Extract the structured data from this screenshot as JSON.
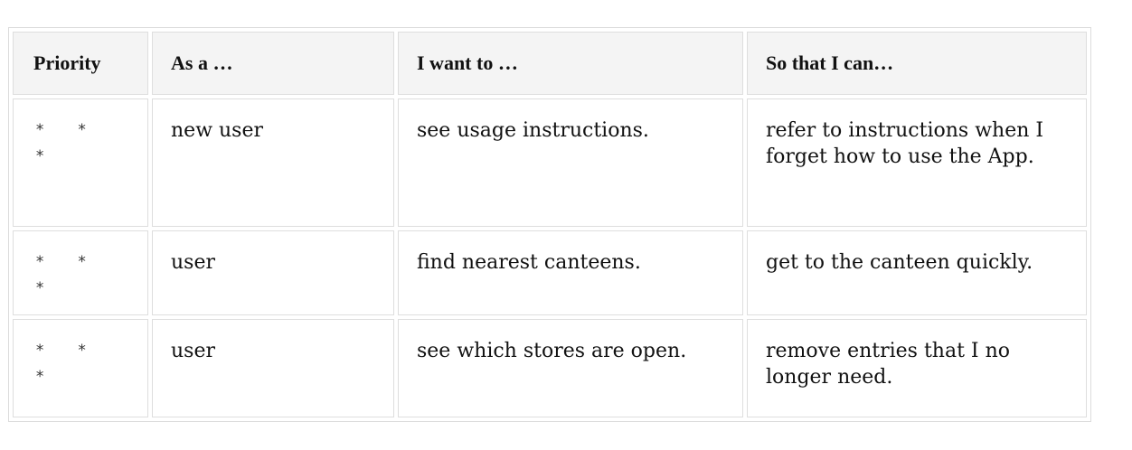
{
  "table": {
    "headers": [
      "Priority",
      "As a …",
      "I want to …",
      "So that I can…"
    ],
    "rows": [
      {
        "priority": "* * *",
        "as_a": "new user",
        "want": "see usage instructions.",
        "so_that": "refer to instructions when I forget how to use the App."
      },
      {
        "priority": "* * *",
        "as_a": "user",
        "want": "find nearest canteens.",
        "so_that": "get to the canteen quickly."
      },
      {
        "priority": "* * *",
        "as_a": "user",
        "want": "see which stores are open.",
        "so_that": "remove entries that I no longer need."
      }
    ]
  }
}
